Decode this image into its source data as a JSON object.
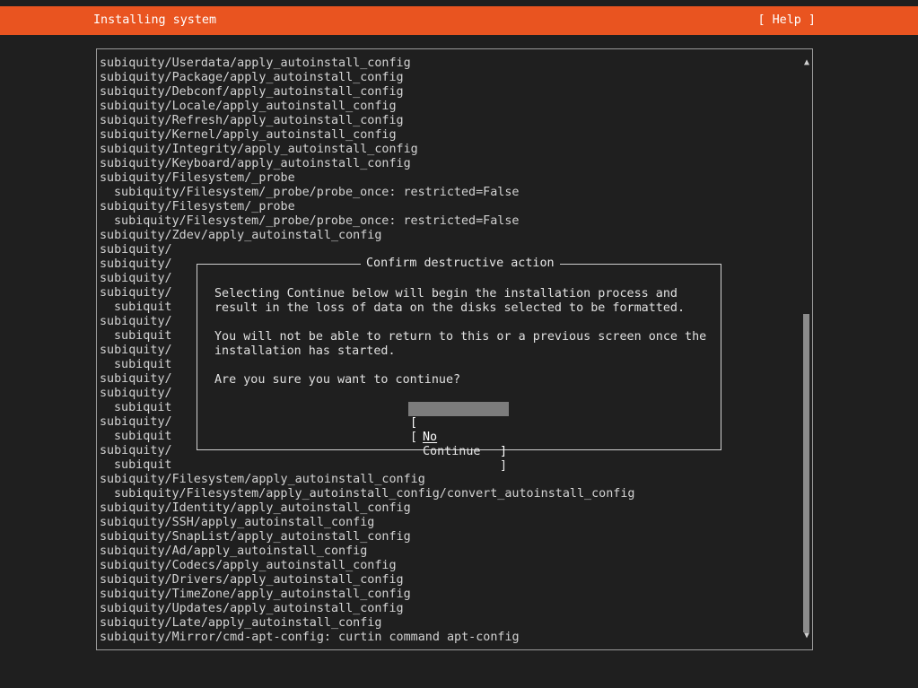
{
  "header": {
    "title": "Installing system",
    "help": "[ Help ]",
    "color": "#e95420"
  },
  "log": {
    "lines": [
      {
        "text": "subiquity/Userdata/apply_autoinstall_config",
        "indent": false
      },
      {
        "text": "subiquity/Package/apply_autoinstall_config",
        "indent": false
      },
      {
        "text": "subiquity/Debconf/apply_autoinstall_config",
        "indent": false
      },
      {
        "text": "subiquity/Locale/apply_autoinstall_config",
        "indent": false
      },
      {
        "text": "subiquity/Refresh/apply_autoinstall_config",
        "indent": false
      },
      {
        "text": "subiquity/Kernel/apply_autoinstall_config",
        "indent": false
      },
      {
        "text": "subiquity/Integrity/apply_autoinstall_config",
        "indent": false
      },
      {
        "text": "subiquity/Keyboard/apply_autoinstall_config",
        "indent": false
      },
      {
        "text": "subiquity/Filesystem/_probe",
        "indent": false
      },
      {
        "text": "subiquity/Filesystem/_probe/probe_once: restricted=False",
        "indent": true
      },
      {
        "text": "subiquity/Filesystem/_probe",
        "indent": false
      },
      {
        "text": "subiquity/Filesystem/_probe/probe_once: restricted=False",
        "indent": true
      },
      {
        "text": "subiquity/Zdev/apply_autoinstall_config",
        "indent": false
      },
      {
        "text": "subiquity/",
        "indent": false
      },
      {
        "text": "subiquity/",
        "indent": false
      },
      {
        "text": "subiquity/",
        "indent": false
      },
      {
        "text": "subiquity/",
        "indent": false
      },
      {
        "text": "subiquit",
        "indent": true
      },
      {
        "text": "subiquity/",
        "indent": false
      },
      {
        "text": "subiquit",
        "indent": true
      },
      {
        "text": "subiquity/",
        "indent": false
      },
      {
        "text": "subiquit",
        "indent": true
      },
      {
        "text": "subiquity/",
        "indent": false
      },
      {
        "text": "subiquity/",
        "indent": false
      },
      {
        "text": "subiquit",
        "indent": true
      },
      {
        "text": "subiquity/",
        "indent": false
      },
      {
        "text": "subiquit",
        "indent": true
      },
      {
        "text": "subiquity/",
        "indent": false
      },
      {
        "text": "subiquit",
        "indent": true
      },
      {
        "text": "subiquity/Filesystem/apply_autoinstall_config",
        "indent": false
      },
      {
        "text": "subiquity/Filesystem/apply_autoinstall_config/convert_autoinstall_config",
        "indent": true
      },
      {
        "text": "subiquity/Identity/apply_autoinstall_config",
        "indent": false
      },
      {
        "text": "subiquity/SSH/apply_autoinstall_config",
        "indent": false
      },
      {
        "text": "subiquity/SnapList/apply_autoinstall_config",
        "indent": false
      },
      {
        "text": "subiquity/Ad/apply_autoinstall_config",
        "indent": false
      },
      {
        "text": "subiquity/Codecs/apply_autoinstall_config",
        "indent": false
      },
      {
        "text": "subiquity/Drivers/apply_autoinstall_config",
        "indent": false
      },
      {
        "text": "subiquity/TimeZone/apply_autoinstall_config",
        "indent": false
      },
      {
        "text": "subiquity/Updates/apply_autoinstall_config",
        "indent": false
      },
      {
        "text": "subiquity/Late/apply_autoinstall_config",
        "indent": false
      },
      {
        "text": "subiquity/Mirror/cmd-apt-config: curtin command apt-config",
        "indent": false
      }
    ],
    "scroll_up": "▲",
    "scroll_down": "▼"
  },
  "dialog": {
    "title": "Confirm destructive action",
    "paragraphs": [
      "Selecting Continue below will begin the installation process and\nresult in the loss of data on the disks selected to be formatted.",
      "You will not be able to return to this or a previous screen once the\ninstallation has started.",
      "Are you sure you want to continue?"
    ],
    "buttons": {
      "no": {
        "left": "[",
        "label": "No",
        "right": "]"
      },
      "continue": {
        "left": "[",
        "label": "Continue",
        "right": "]"
      }
    }
  }
}
